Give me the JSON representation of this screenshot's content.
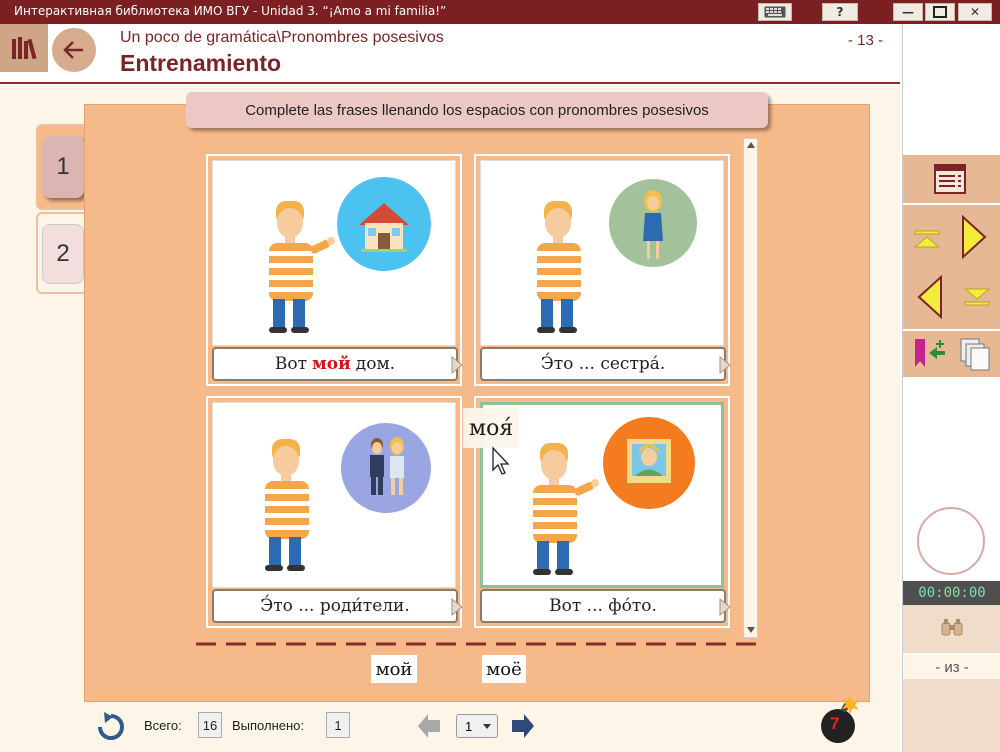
{
  "window": {
    "title": "Интерактивная библиотека ИМО ВГУ  -  Unidad 3. “¡Amo a mi familia!”",
    "help_label": "?",
    "minimize_label": "—",
    "close_label": "✕"
  },
  "header": {
    "breadcrumb": "Un poco de gramática\\Pronombres posesivos",
    "title": "Entrenamiento",
    "page_number": "- 13 -"
  },
  "exercise": {
    "instruction": "Complete las frases llenando los espacios con pronombres posesivos",
    "tabs": [
      {
        "label": "1",
        "active": true
      },
      {
        "label": "2",
        "active": false
      }
    ],
    "cards": [
      {
        "pre": "Вот",
        "filled": "мой",
        "post": "дом."
      },
      {
        "text": "Э́то ... сестра́."
      },
      {
        "text": "Э́то ... роди́тели."
      },
      {
        "text": "Вот ... фо́то."
      }
    ],
    "dragging_word": "моя́",
    "answer_words": [
      "мой",
      "моё"
    ]
  },
  "footer": {
    "total_label": "Всего:",
    "total_value": "16",
    "done_label": "Выполнено:",
    "done_value": "1",
    "page_select": "1",
    "attempts_left": "7"
  },
  "sidebar": {
    "timer": "00:00:00",
    "page_of": "- из -"
  },
  "colors": {
    "brand": "#7b1f22",
    "panel": "#f6b989",
    "sidebar_accent": "#e7b894",
    "nav_arrow": "#f4ec3b"
  }
}
